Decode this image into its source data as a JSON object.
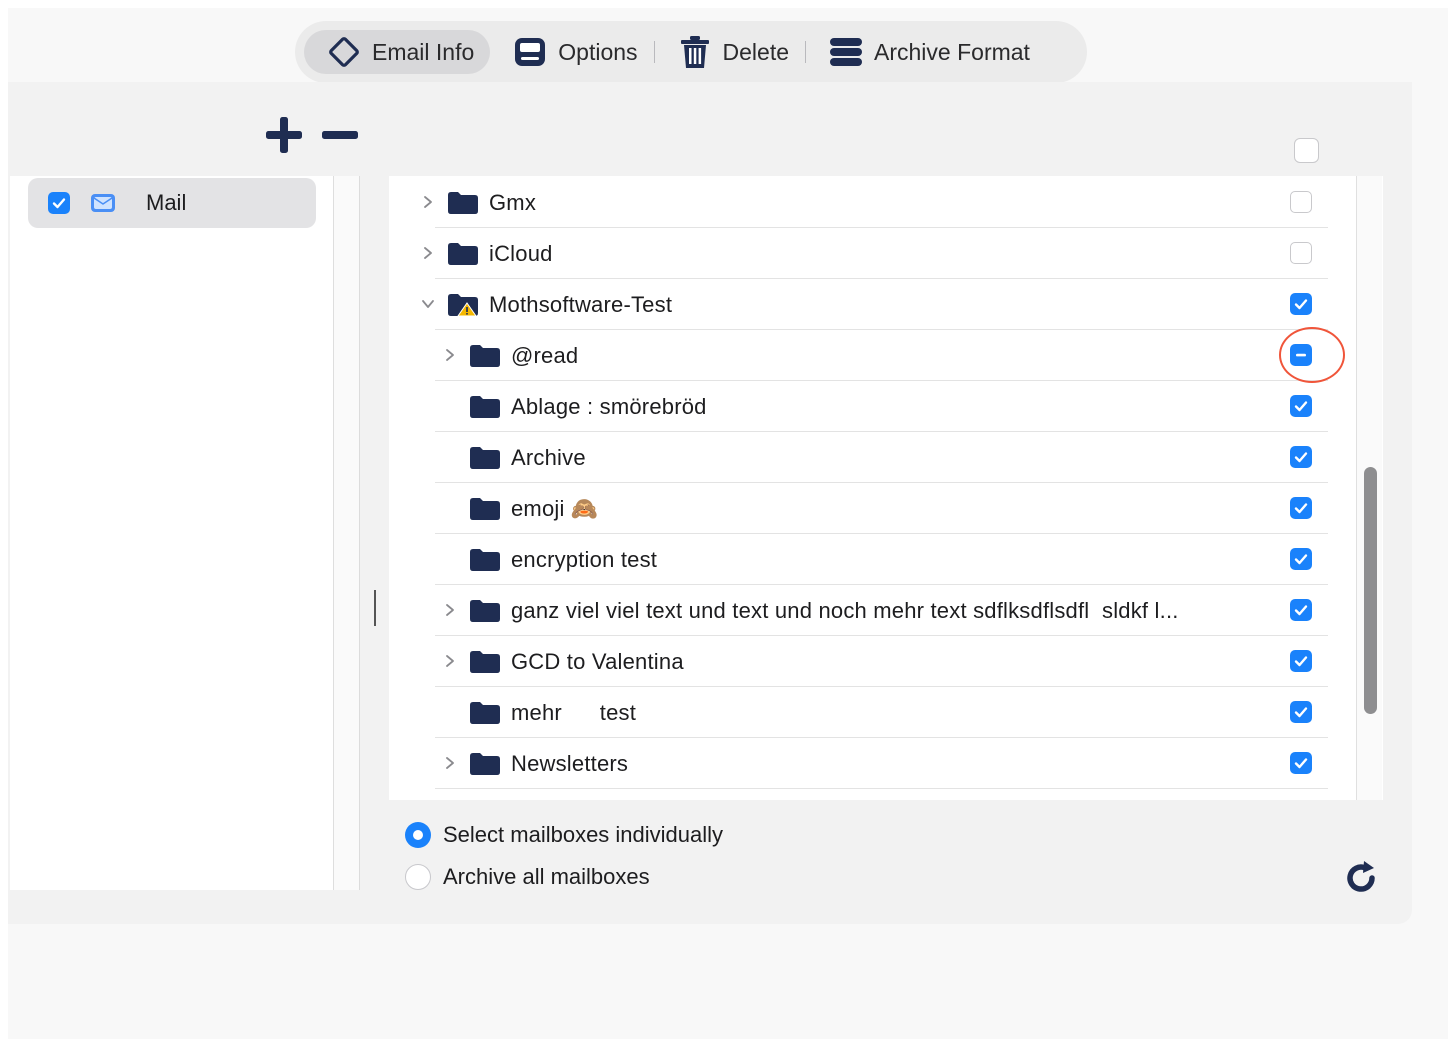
{
  "toolbar": {
    "items": [
      {
        "label": "Email Info",
        "icon": "diamond-icon"
      },
      {
        "label": "Options",
        "icon": "options-icon"
      },
      {
        "label": "Delete",
        "icon": "trash-icon"
      },
      {
        "label": "Archive Format",
        "icon": "stack-icon"
      }
    ]
  },
  "sidebar": {
    "items": [
      {
        "label": "Mail",
        "checked": true
      }
    ]
  },
  "mailboxes": [
    {
      "name": "Gmx",
      "state": "unchecked",
      "expandable": true,
      "expanded": false,
      "level": 0
    },
    {
      "name": "iCloud",
      "state": "unchecked",
      "expandable": true,
      "expanded": false,
      "level": 0
    },
    {
      "name": "Mothsoftware-Test",
      "state": "checked",
      "expandable": true,
      "expanded": true,
      "level": 0,
      "warning": true
    },
    {
      "name": "@read",
      "state": "mixed",
      "expandable": true,
      "expanded": false,
      "level": 1
    },
    {
      "name": "Ablage : smörebröd",
      "state": "checked",
      "expandable": false,
      "level": 1
    },
    {
      "name": "Archive",
      "state": "checked",
      "expandable": false,
      "level": 1
    },
    {
      "name": "emoji 🙈",
      "state": "checked",
      "expandable": false,
      "level": 1
    },
    {
      "name": "encryption test",
      "state": "checked",
      "expandable": false,
      "level": 1
    },
    {
      "name": "ganz viel viel text und text und noch mehr text sdflksdflsdfl  sldkf l...",
      "state": "checked",
      "expandable": true,
      "expanded": false,
      "level": 1
    },
    {
      "name": "GCD to Valentina",
      "state": "checked",
      "expandable": true,
      "expanded": false,
      "level": 1
    },
    {
      "name": "mehr      test",
      "state": "checked",
      "expandable": false,
      "level": 1
    },
    {
      "name": "Newsletters",
      "state": "checked",
      "expandable": true,
      "expanded": false,
      "level": 1
    }
  ],
  "options": {
    "select_individually": "Select mailboxes individually",
    "archive_all": "Archive all mailboxes",
    "selected": "select_individually"
  },
  "colors": {
    "accent": "#1a82fb",
    "folder": "#1f2d52",
    "highlight": "#f0553a"
  }
}
